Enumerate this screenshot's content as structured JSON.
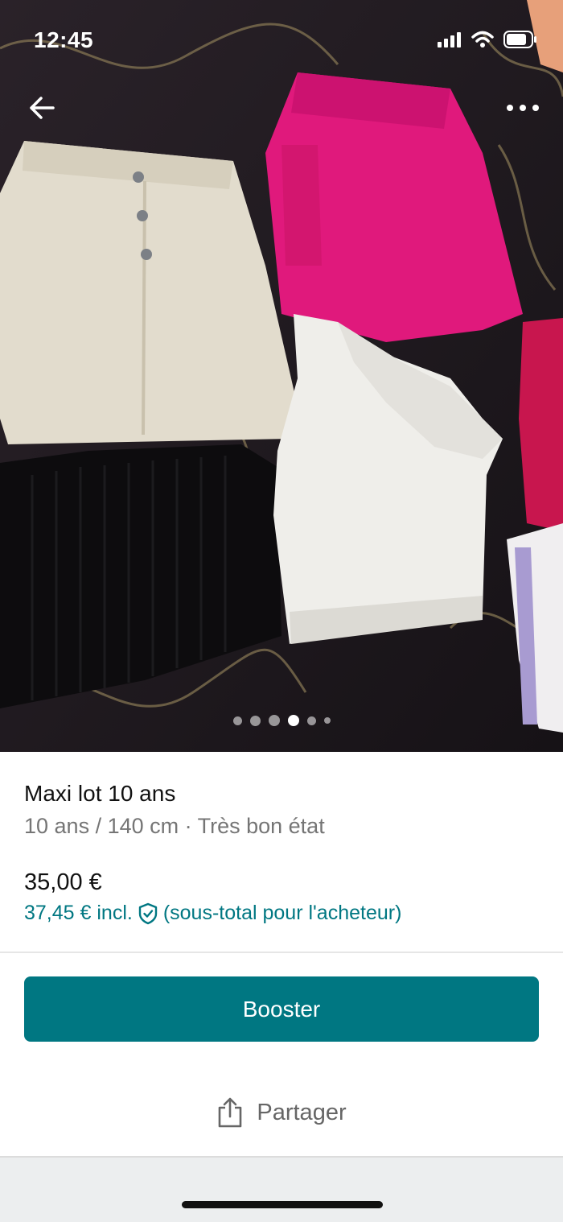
{
  "status_bar": {
    "time": "12:45"
  },
  "photo": {
    "image_count": 6,
    "active_index": 3
  },
  "item": {
    "title": "Maxi lot 10 ans",
    "subtitle": "10 ans / 140 cm · Très bon état",
    "price": "35,00 €",
    "price_incl": "37,45 € incl.",
    "price_incl_note": "(sous-total pour l'acheteur)"
  },
  "actions": {
    "booster_label": "Booster",
    "share_label": "Partager"
  },
  "colors": {
    "accent": "#007782",
    "text": "#111111",
    "muted": "#757575"
  },
  "icons": [
    "back-arrow-icon",
    "more-options-icon",
    "signal-icon",
    "wifi-icon",
    "battery-icon",
    "shield-check-icon",
    "share-icon"
  ]
}
